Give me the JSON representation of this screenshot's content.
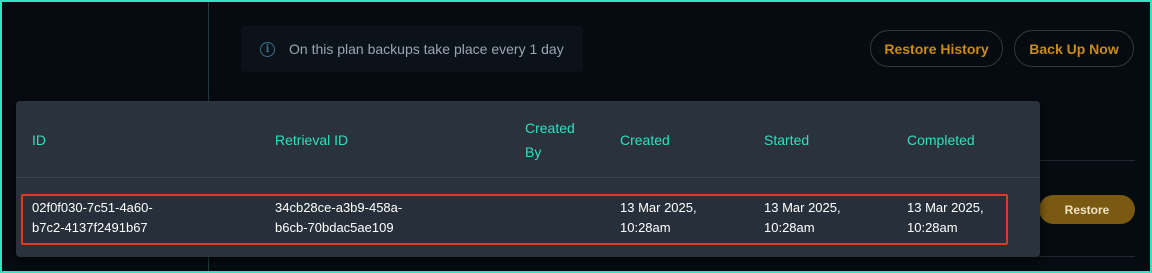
{
  "info_banner": {
    "icon": "info-circle-icon",
    "text": "On this plan backups take place every 1 day"
  },
  "actions": {
    "restore_history": "Restore History",
    "back_up_now": "Back Up Now"
  },
  "table": {
    "columns": {
      "id": "ID",
      "retrieval_id": "Retrieval ID",
      "created_by_line1": "Created",
      "created_by_line2": "By",
      "created": "Created",
      "started": "Started",
      "completed": "Completed"
    },
    "rows": [
      {
        "id_line1": "02f0f030-7c51-4a60-",
        "id_line2": "b7c2-4137f2491b67",
        "retrieval_line1": "34cb28ce-a3b9-458a-",
        "retrieval_line2": "b6cb-70bdac5ae109",
        "created_by": "",
        "created_line1": "13 Mar 2025,",
        "created_line2": "10:28am",
        "started_line1": "13 Mar 2025,",
        "started_line2": "10:28am",
        "completed_line1": "13 Mar 2025,",
        "completed_line2": "10:28am",
        "restore_label": "Restore"
      }
    ]
  },
  "colors": {
    "accent": "#2ee6c2",
    "button_text": "#c98a17",
    "highlight": "#e03a22"
  }
}
